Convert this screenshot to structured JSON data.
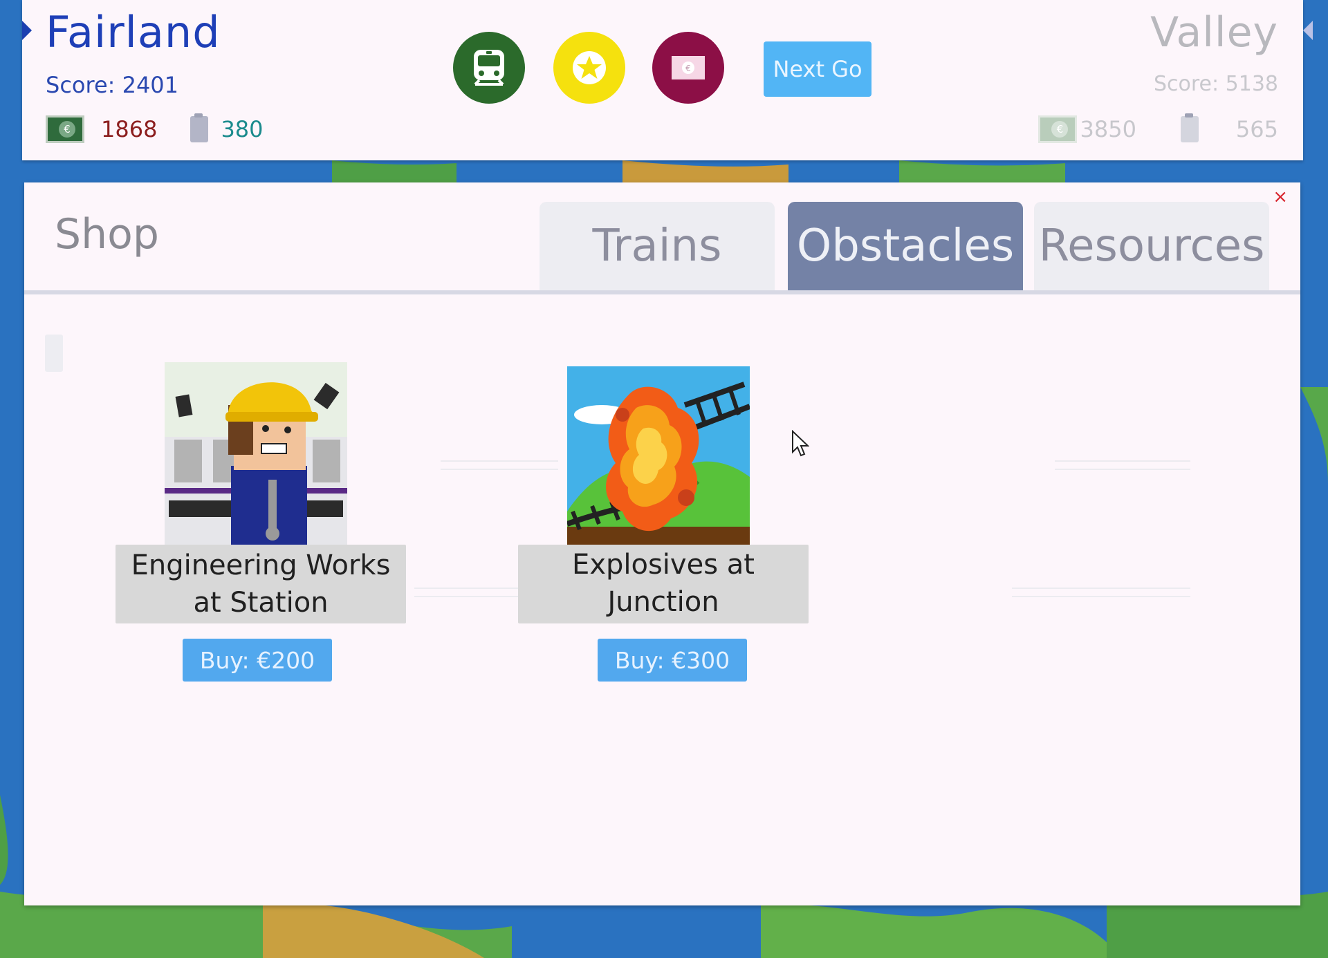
{
  "players": {
    "left": {
      "name": "Fairland",
      "score": "Score: 2401",
      "money": "1868",
      "fuel": "380",
      "active": true
    },
    "right": {
      "name": "Valley",
      "score": "Score: 5138",
      "money": "3850",
      "fuel": "565",
      "active": false
    }
  },
  "toolbar": {
    "trains_icon": "train-icon",
    "goals_icon": "star-icon",
    "shop_icon": "money-icon",
    "next_go_label": "Next Go"
  },
  "shop": {
    "title": "Shop",
    "close_label": "×",
    "tabs": [
      {
        "label": "Trains",
        "active": false
      },
      {
        "label": "Obstacles",
        "active": true
      },
      {
        "label": "Resources",
        "active": false
      }
    ],
    "items": [
      {
        "name": "Engineering Works at Station",
        "name_line1": "Engineering Works",
        "name_line2": "at Station",
        "buy_label": "Buy: €200",
        "icon": "engineer-icon"
      },
      {
        "name": "Explosives at Junction",
        "buy_label": "Buy: €300",
        "icon": "explosion-icon"
      }
    ]
  },
  "colors": {
    "active_player": "#1e3fb7",
    "inactive_player": "#b8b8bd",
    "active_tab": "#7482a6",
    "buy_button": "#52a8ee",
    "next_go_button": "#52b5f5"
  }
}
